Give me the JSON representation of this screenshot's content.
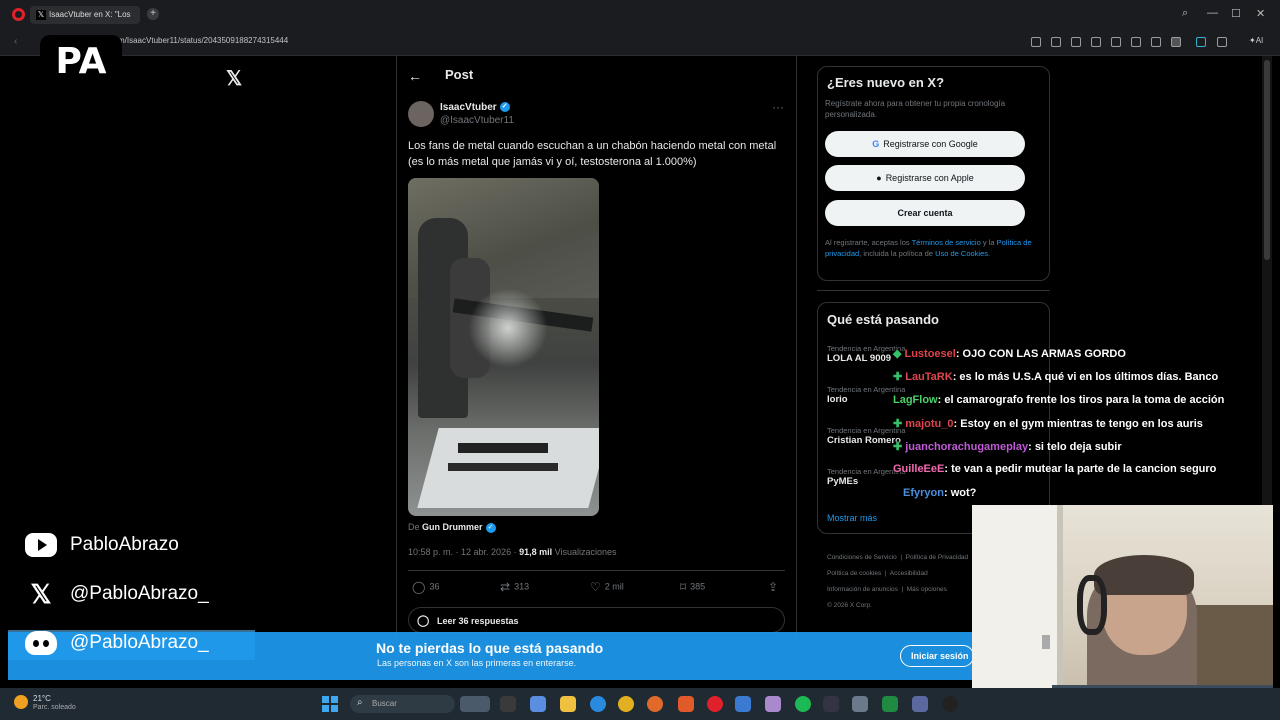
{
  "browser": {
    "tab_title": "IsaacVtuber en X: \"Los",
    "url": "m/IsaacVtuber11/status/2043509188274315444",
    "ai_label": "AI"
  },
  "stream": {
    "logo_text": "PA",
    "socials": [
      {
        "icon": "youtube-icon",
        "label": "PabloAbrazo"
      },
      {
        "icon": "x-icon",
        "label": "@PabloAbrazo_"
      },
      {
        "icon": "discord-icon",
        "label": "@PabloAbrazo_"
      }
    ],
    "chat": [
      {
        "user": "Lustoesel",
        "color": "#e0444c",
        "message": ": OJO CON LAS ARMAS GORDO"
      },
      {
        "user": "LauTaRK",
        "color": "#e0444c",
        "message": ": es lo más U.S.A qué vi en los últimos días. Banco"
      },
      {
        "user": "LagFlow",
        "color": "#4cd26a",
        "message": ": el camarografo frente los tiros para la toma de acción"
      },
      {
        "user": "majotu_0",
        "color": "#e0444c",
        "message": ": Estoy en el gym mientras te tengo en los auris"
      },
      {
        "user": "juanchorachugameplay",
        "color": "#c05ad8",
        "message": ": si telo deja subir"
      },
      {
        "user": "GuilleEeE",
        "color": "#f06ab0",
        "message": ": te van a pedir mutear la parte de la cancion seguro"
      },
      {
        "user": "Efyryon",
        "color": "#4a8ee0",
        "message": ": wot?"
      }
    ]
  },
  "post": {
    "header": "Post",
    "author_name": "IsaacVtuber",
    "author_handle": "@IsaacVtuber11",
    "text": "Los fans de metal cuando escuchan a un chabón haciendo metal con metal (es lo más metal que jamás vi y oí, testosterona al 1.000%)",
    "from_prefix": "De ",
    "from_account": "Gun Drummer",
    "time": "10:58 p. m. · 12 abr. 2026 · ",
    "views": "91,8 mil",
    "views_label": " Visualizaciones",
    "actions": {
      "replies": "36",
      "reposts": "313",
      "likes": "2 mil",
      "bookmarks": "385"
    },
    "read_replies": "Leer 36 respuestas"
  },
  "sidebar": {
    "signup_title": "¿Eres nuevo en X?",
    "signup_sub": "Regístrate ahora para obtener tu propia cronología personalizada.",
    "google_btn": "Registrarse con Google",
    "apple_btn": "Registrarse con Apple",
    "create_btn": "Crear cuenta",
    "legal_prefix": "Al registrarte, aceptas los ",
    "legal_terms": "Términos de servicio",
    "legal_and": " y la ",
    "legal_privacy": "Política de privacidad",
    "legal_mid": ", incluida la política de ",
    "legal_cookies": "Uso de Cookies",
    "legal_end": ".",
    "trends_title": "Qué está pasando",
    "trends": [
      {
        "context": "Tendencia en Argentina",
        "name": "LOLA AL 9009"
      },
      {
        "context": "Tendencia en Argentina",
        "name": "Iorio"
      },
      {
        "context": "Tendencia en Argentina",
        "name": "Cristian Romero"
      },
      {
        "context": "Tendencia en Argentina",
        "name": "PyMEs"
      }
    ],
    "show_more": "Mostrar más",
    "footer": [
      "Condiciones de Servicio",
      "Política de Privacidad",
      "Política de cookies",
      "Accesibilidad",
      "Información de anuncios",
      "Más opciones",
      "© 2026 X Corp."
    ]
  },
  "banner": {
    "title": "No te pierdas lo que está pasando",
    "subtitle": "Las personas en X son las primeras en enterarse.",
    "login": "Iniciar sesión"
  },
  "taskbar": {
    "temperature": "21°C",
    "weather": "Parc. soleado",
    "search_placeholder": "Buscar"
  }
}
